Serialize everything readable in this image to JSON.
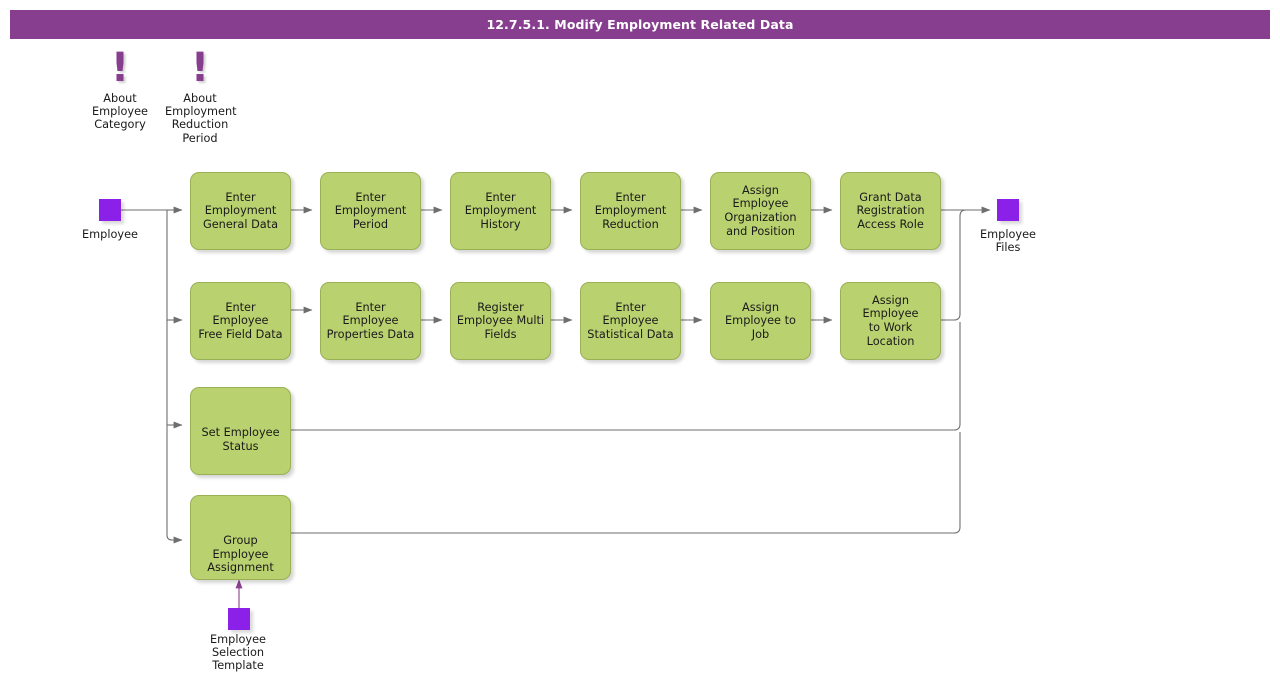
{
  "header": {
    "title": "12.7.5.1. Modify Employment Related Data",
    "bar_color": "#873E8F",
    "text_color": "#FFFFFF"
  },
  "palette": {
    "process_fill": "#B9D16F",
    "process_border": "#9AB054",
    "data_node": "#8B21E8",
    "connector": "#6E6E6E",
    "note_accent": "#873E8F",
    "background": "#FFFFFF"
  },
  "notes": [
    {
      "icon": "exclamation-icon",
      "glyph": "!",
      "text": "About\nEmployee\nCategory"
    },
    {
      "icon": "exclamation-icon",
      "glyph": "!",
      "text": "About\nEmployment\nReduction\nPeriod"
    }
  ],
  "data_nodes": {
    "input": {
      "label": "Employee",
      "icon": "data-object-icon"
    },
    "output": {
      "label": "Employee\nFiles",
      "icon": "data-object-icon"
    },
    "template": {
      "label": "Employee\nSelection\nTemplate",
      "icon": "data-object-icon"
    }
  },
  "rows": [
    {
      "name": "employment-data-row",
      "steps": [
        "Enter\nEmployment\nGeneral Data",
        "Enter\nEmployment\nPeriod",
        "Enter\nEmployment\nHistory",
        "Enter\nEmployment\nReduction",
        "Assign\nEmployee\nOrganization\nand Position",
        "Grant Data\nRegistration\nAccess Role"
      ]
    },
    {
      "name": "employee-detail-row",
      "steps": [
        "Enter Employee\nFree Field Data",
        "Enter Employee\nProperties Data",
        "Register\nEmployee Multi\nFields",
        "Enter Employee\nStatistical Data",
        "Assign\nEmployee to Job",
        "Assign Employee\nto Work Location"
      ]
    },
    {
      "name": "status-row",
      "steps": [
        "Set Employee\nStatus"
      ]
    },
    {
      "name": "grouping-row",
      "steps": [
        "Group Employee\nAssignment"
      ]
    }
  ]
}
